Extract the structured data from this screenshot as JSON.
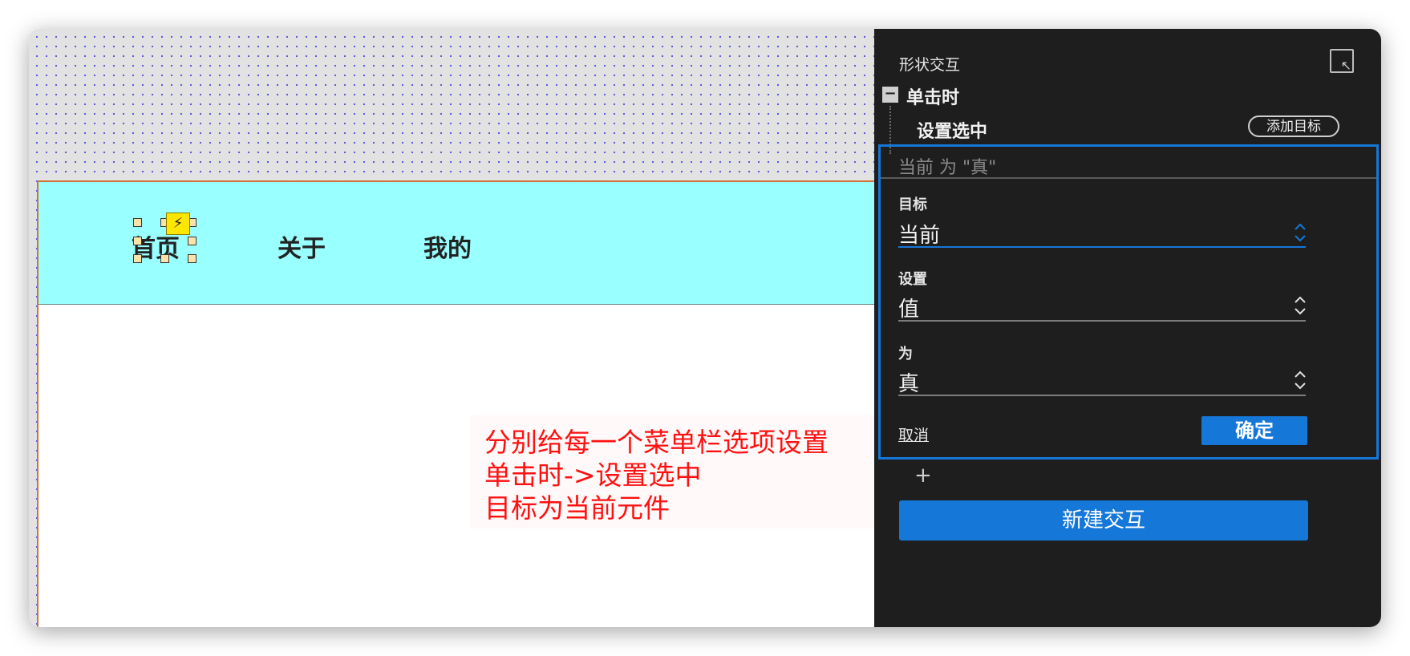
{
  "canvas": {
    "nav_items": [
      "首页",
      "关于",
      "我的"
    ],
    "annotation_lines": [
      "分别给每一个菜单栏选项设置",
      "单击时->设置选中",
      "目标为当前元件"
    ]
  },
  "panel": {
    "title": "形状交互",
    "collapse_icon": "collapse-panel-icon",
    "event": {
      "label": "单击时",
      "toggle_icon": "minus-icon"
    },
    "action": {
      "label": "设置选中",
      "add_target_label": "添加目标"
    },
    "editor": {
      "summary": "当前 为 \"真\"",
      "fields": [
        {
          "label": "目标",
          "value": "当前"
        },
        {
          "label": "设置",
          "value": "值"
        },
        {
          "label": "为",
          "value": "真"
        }
      ],
      "cancel_label": "取消",
      "ok_label": "确定"
    },
    "add_action_icon": "+",
    "new_interaction_label": "新建交互"
  },
  "colors": {
    "navbar_bg": "#99ffff",
    "accent_blue": "#1577d8",
    "annotation_red": "#ff1111",
    "panel_bg": "#1e1e1e"
  }
}
